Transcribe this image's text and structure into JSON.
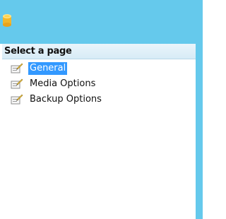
{
  "window": {
    "icon": "database-icon",
    "accent_color": "#65c9ec"
  },
  "panel": {
    "title": "Select a page",
    "items": [
      {
        "label": "General",
        "icon": "properties-page-icon",
        "selected": true
      },
      {
        "label": "Media Options",
        "icon": "properties-page-icon",
        "selected": false
      },
      {
        "label": "Backup Options",
        "icon": "properties-page-icon",
        "selected": false
      }
    ],
    "selection_color": "#3399ff"
  }
}
